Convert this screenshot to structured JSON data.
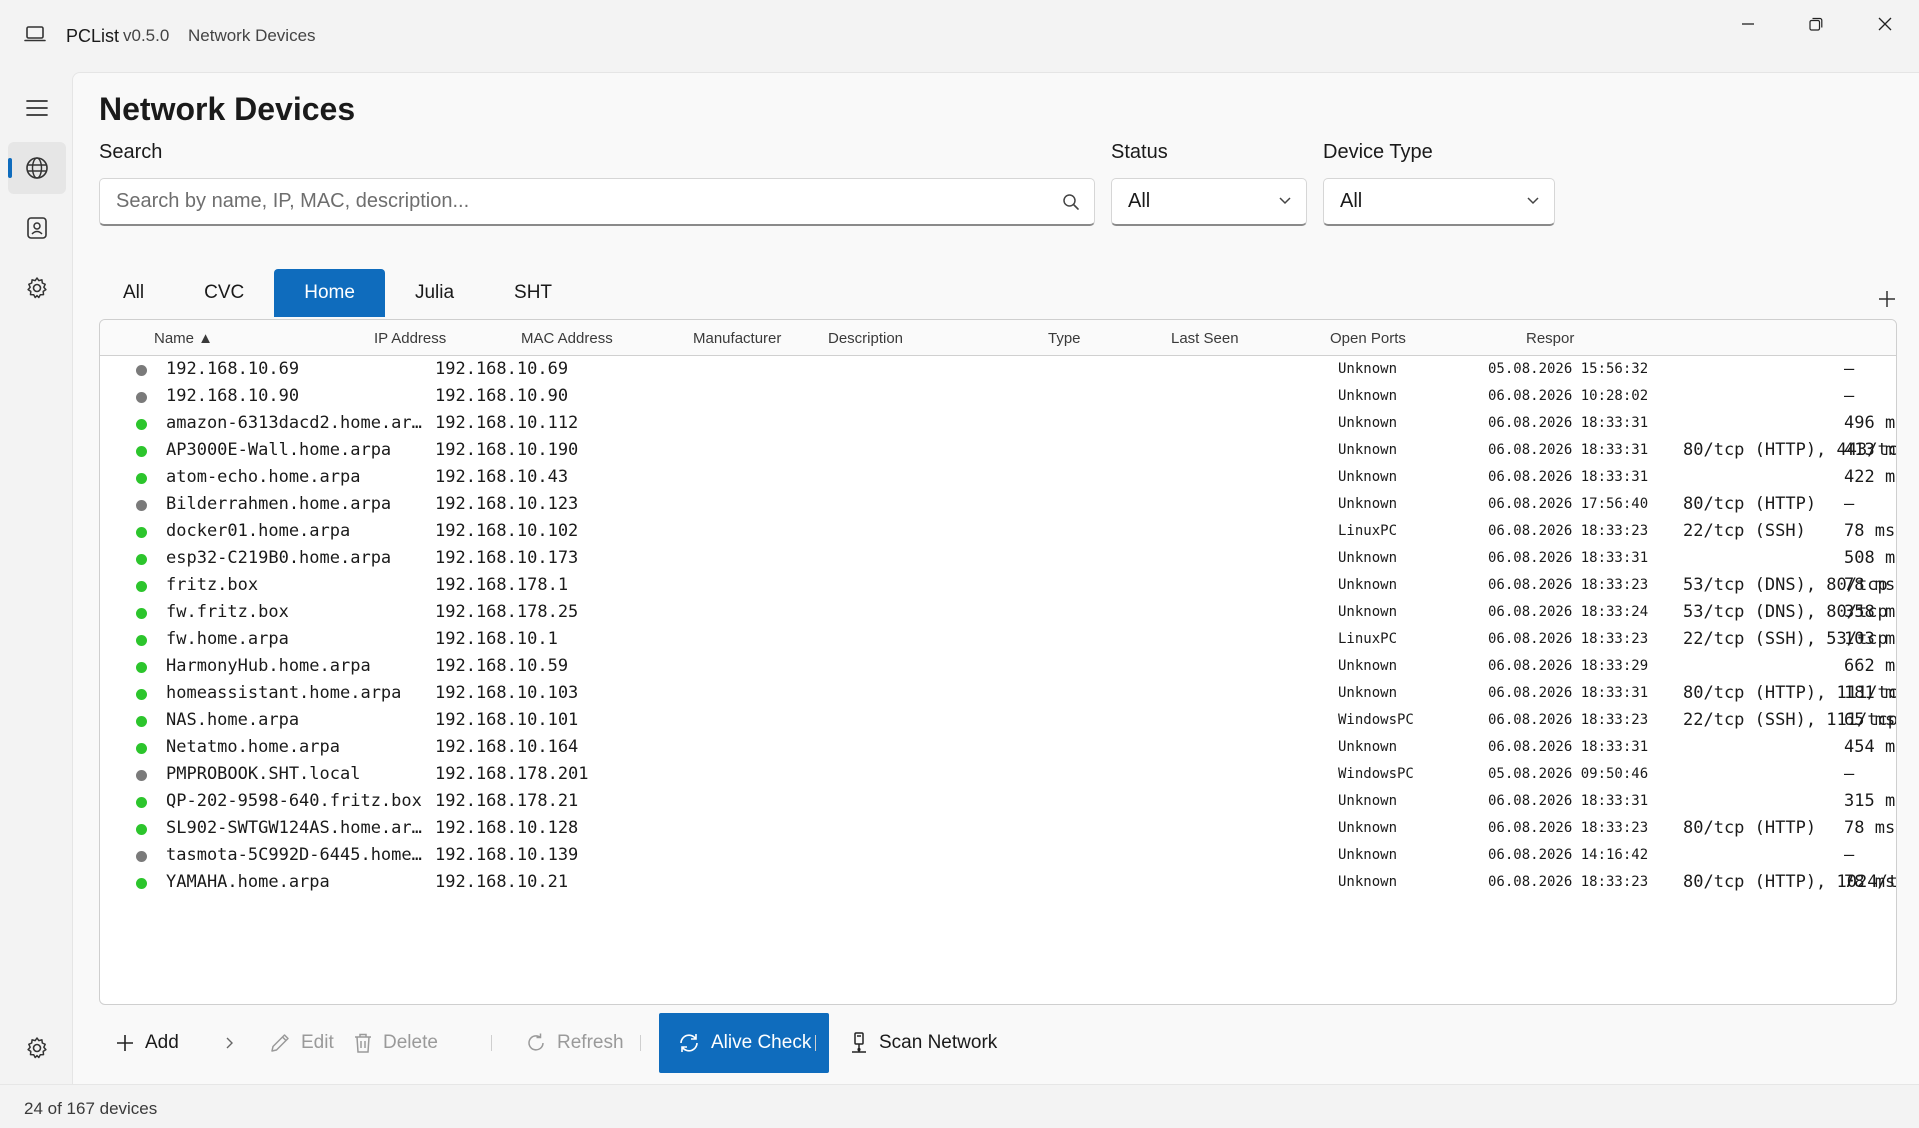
{
  "window": {
    "app_name": "PCList",
    "version": "v0.5.0",
    "page_name": "Network Devices"
  },
  "page": {
    "title": "Network Devices",
    "search_label": "Search",
    "search_placeholder": "Search by name, IP, MAC, description...",
    "status_label": "Status",
    "status_value": "All",
    "device_type_label": "Device Type",
    "device_type_value": "All"
  },
  "tabs": [
    {
      "label": "All",
      "active": false
    },
    {
      "label": "CVC",
      "active": false
    },
    {
      "label": "Home",
      "active": true
    },
    {
      "label": "Julia",
      "active": false
    },
    {
      "label": "SHT",
      "active": false
    }
  ],
  "table": {
    "columns": {
      "name": "Name ▲",
      "ip": "IP Address",
      "mac": "MAC Address",
      "manufacturer": "Manufacturer",
      "description": "Description",
      "type": "Type",
      "last_seen": "Last Seen",
      "open_ports": "Open Ports",
      "response": "Respor"
    },
    "rows": [
      {
        "online": false,
        "name": "192.168.10.69",
        "ip": "192.168.10.69",
        "type": "Unknown",
        "last_seen": "05.08.2026 15:56:32",
        "ports": "",
        "resp": "–"
      },
      {
        "online": false,
        "name": "192.168.10.90",
        "ip": "192.168.10.90",
        "type": "Unknown",
        "last_seen": "06.08.2026 10:28:02",
        "ports": "",
        "resp": "–"
      },
      {
        "online": true,
        "name": "amazon-6313dacd2.home.ar…",
        "ip": "192.168.10.112",
        "type": "Unknown",
        "last_seen": "06.08.2026 18:33:31",
        "ports": "",
        "resp": "496 m"
      },
      {
        "online": true,
        "name": "AP3000E-Wall.home.arpa",
        "ip": "192.168.10.190",
        "type": "Unknown",
        "last_seen": "06.08.2026 18:33:31",
        "ports": "80/tcp (HTTP), 443/tcp…",
        "resp": "413 m"
      },
      {
        "online": true,
        "name": "atom-echo.home.arpa",
        "ip": "192.168.10.43",
        "type": "Unknown",
        "last_seen": "06.08.2026 18:33:31",
        "ports": "",
        "resp": "422 m"
      },
      {
        "online": false,
        "name": "Bilderrahmen.home.arpa",
        "ip": "192.168.10.123",
        "type": "Unknown",
        "last_seen": "06.08.2026 17:56:40",
        "ports": "80/tcp (HTTP)",
        "resp": "–"
      },
      {
        "online": true,
        "name": "docker01.home.arpa",
        "ip": "192.168.10.102",
        "type": "LinuxPC",
        "last_seen": "06.08.2026 18:33:23",
        "ports": "22/tcp (SSH)",
        "resp": "78 ms"
      },
      {
        "online": true,
        "name": "esp32-C219B0.home.arpa",
        "ip": "192.168.10.173",
        "type": "Unknown",
        "last_seen": "06.08.2026 18:33:31",
        "ports": "",
        "resp": "508 m"
      },
      {
        "online": true,
        "name": "fritz.box",
        "ip": "192.168.178.1",
        "type": "Unknown",
        "last_seen": "06.08.2026 18:33:23",
        "ports": "53/tcp (DNS), 80/tcp (H…",
        "resp": "78 ms"
      },
      {
        "online": true,
        "name": "fw.fritz.box",
        "ip": "192.168.178.25",
        "type": "Unknown",
        "last_seen": "06.08.2026 18:33:24",
        "ports": "53/tcp (DNS), 80/tcp (H…",
        "resp": "358 m"
      },
      {
        "online": true,
        "name": "fw.home.arpa",
        "ip": "192.168.10.1",
        "type": "LinuxPC",
        "last_seen": "06.08.2026 18:33:23",
        "ports": "22/tcp (SSH), 53/tcp (D…",
        "resp": "103 m"
      },
      {
        "online": true,
        "name": "HarmonyHub.home.arpa",
        "ip": "192.168.10.59",
        "type": "Unknown",
        "last_seen": "06.08.2026 18:33:29",
        "ports": "",
        "resp": "662 m"
      },
      {
        "online": true,
        "name": "homeassistant.home.arpa",
        "ip": "192.168.10.103",
        "type": "Unknown",
        "last_seen": "06.08.2026 18:33:31",
        "ports": "80/tcp (HTTP), 111/tcp",
        "resp": "181 m"
      },
      {
        "online": true,
        "name": "NAS.home.arpa",
        "ip": "192.168.10.101",
        "type": "WindowsPC",
        "last_seen": "06.08.2026 18:33:23",
        "ports": "22/tcp (SSH), 111/tcp,…",
        "resp": "65 ms"
      },
      {
        "online": true,
        "name": "Netatmo.home.arpa",
        "ip": "192.168.10.164",
        "type": "Unknown",
        "last_seen": "06.08.2026 18:33:31",
        "ports": "",
        "resp": "454 m"
      },
      {
        "online": false,
        "name": "PMPROBOOK.SHT.local",
        "ip": "192.168.178.201",
        "type": "WindowsPC",
        "last_seen": "05.08.2026 09:50:46",
        "ports": "",
        "resp": "–"
      },
      {
        "online": true,
        "name": "QP-202-9598-640.fritz.box",
        "ip": "192.168.178.21",
        "type": "Unknown",
        "last_seen": "06.08.2026 18:33:31",
        "ports": "",
        "resp": "315 m"
      },
      {
        "online": true,
        "name": "SL902-SWTGW124AS.home.ar…",
        "ip": "192.168.10.128",
        "type": "Unknown",
        "last_seen": "06.08.2026 18:33:23",
        "ports": "80/tcp (HTTP)",
        "resp": "78 ms"
      },
      {
        "online": false,
        "name": "tasmota-5C992D-6445.home…",
        "ip": "192.168.10.139",
        "type": "Unknown",
        "last_seen": "06.08.2026 14:16:42",
        "ports": "",
        "resp": "–"
      },
      {
        "online": true,
        "name": "YAMAHA.home.arpa",
        "ip": "192.168.10.21",
        "type": "Unknown",
        "last_seen": "06.08.2026 18:33:23",
        "ports": "80/tcp (HTTP), 1024/tcp",
        "resp": "78 ms"
      }
    ]
  },
  "toolbar": {
    "add": "Add",
    "edit": "Edit",
    "delete": "Delete",
    "refresh": "Refresh",
    "alive_check": "Alive Check",
    "scan_network": "Scan Network"
  },
  "status": {
    "text": "24 of 167 devices"
  },
  "colors": {
    "accent": "#0f6cbd",
    "online": "#2cc52c",
    "offline": "#7a7a7a"
  },
  "icons": [
    "laptop-icon",
    "minimize-icon",
    "restore-icon",
    "close-icon",
    "hamburger-icon",
    "globe-icon",
    "contact-icon",
    "gear-icon",
    "search-icon",
    "chevron-down-icon",
    "plus-icon",
    "chevron-right-icon",
    "pencil-icon",
    "trash-icon",
    "refresh-icon",
    "sync-icon",
    "network-icon"
  ]
}
